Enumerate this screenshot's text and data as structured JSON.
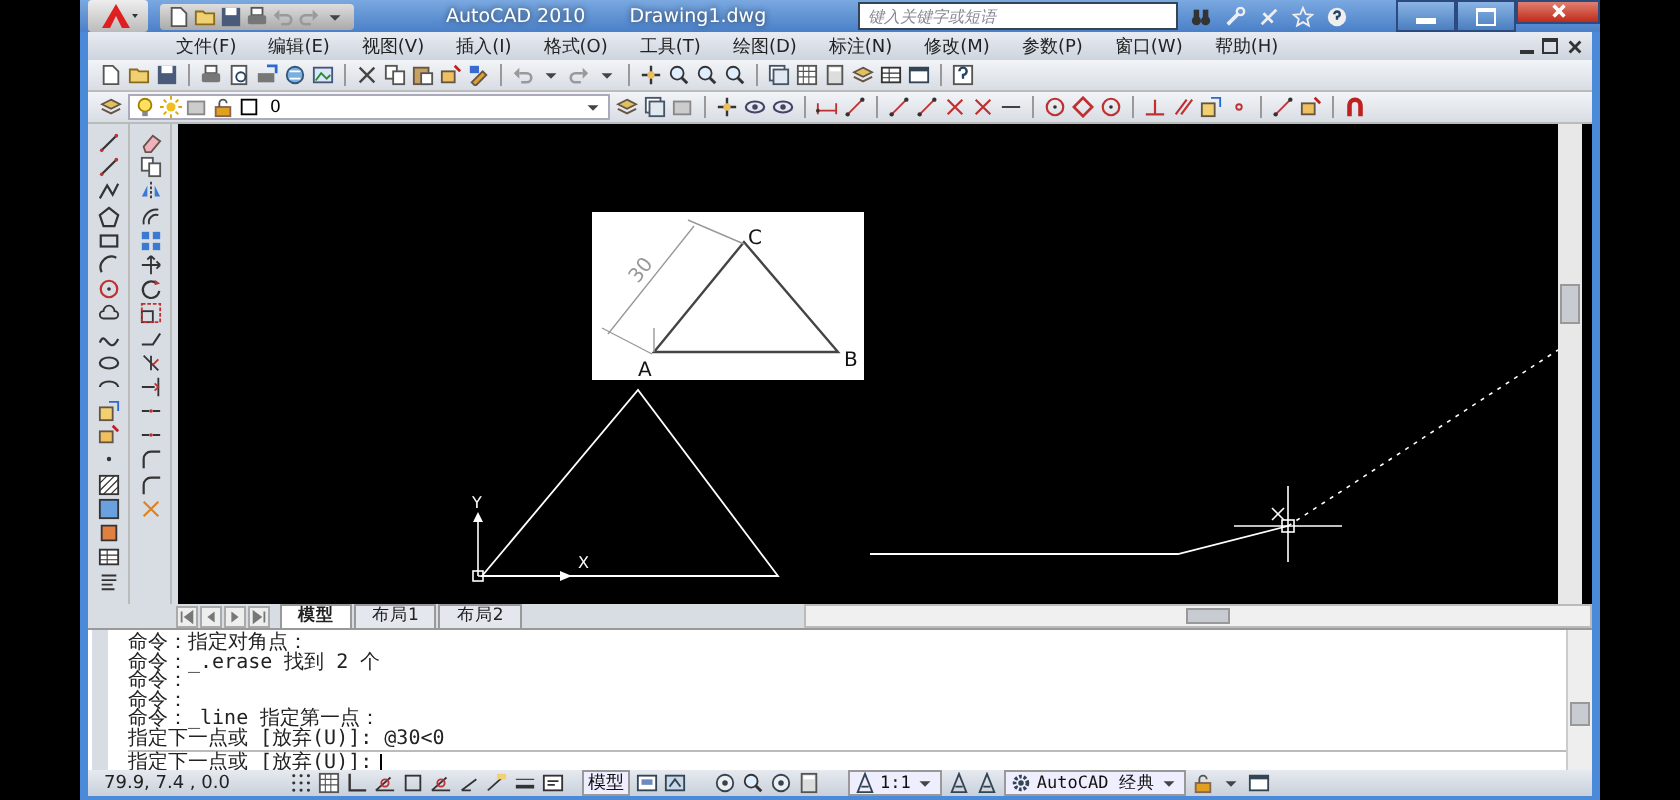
{
  "title_bar": {
    "app": "AutoCAD 2010",
    "file": "Drawing1.dwg",
    "search": {
      "placeholder": "键入关键字或短语"
    }
  },
  "menu_bar": [
    "文件(F)",
    "编辑(E)",
    "视图(V)",
    "插入(I)",
    "格式(O)",
    "工具(T)",
    "绘图(D)",
    "标注(N)",
    "修改(M)",
    "参数(P)",
    "窗口(W)",
    "帮助(H)"
  ],
  "layer_bar": {
    "layer": "0"
  },
  "reference_image": {
    "dimension": "30",
    "vertex_labels": [
      "A",
      "B",
      "C"
    ]
  },
  "ucs_icon": {
    "x_label": "X",
    "y_label": "Y"
  },
  "layout_tabs": [
    {
      "label": "模型",
      "selected": true
    },
    {
      "label": "布局1",
      "selected": false
    },
    {
      "label": "布局2",
      "selected": false
    }
  ],
  "command_history": [
    "命令：指定对角点：",
    "命令：_.erase 找到 2 个",
    "命令：",
    "命令：",
    "命令：_line 指定第一点：",
    "指定下一点或 [放弃(U)]: @30<0"
  ],
  "command_prompt": "指定下一点或 [放弃(U)]:",
  "status_bar": {
    "coordinates": "79.9, 7.4 , 0.0",
    "model_label": "模型",
    "annotation_scale": "1:1",
    "workspace": "AutoCAD 经典"
  }
}
